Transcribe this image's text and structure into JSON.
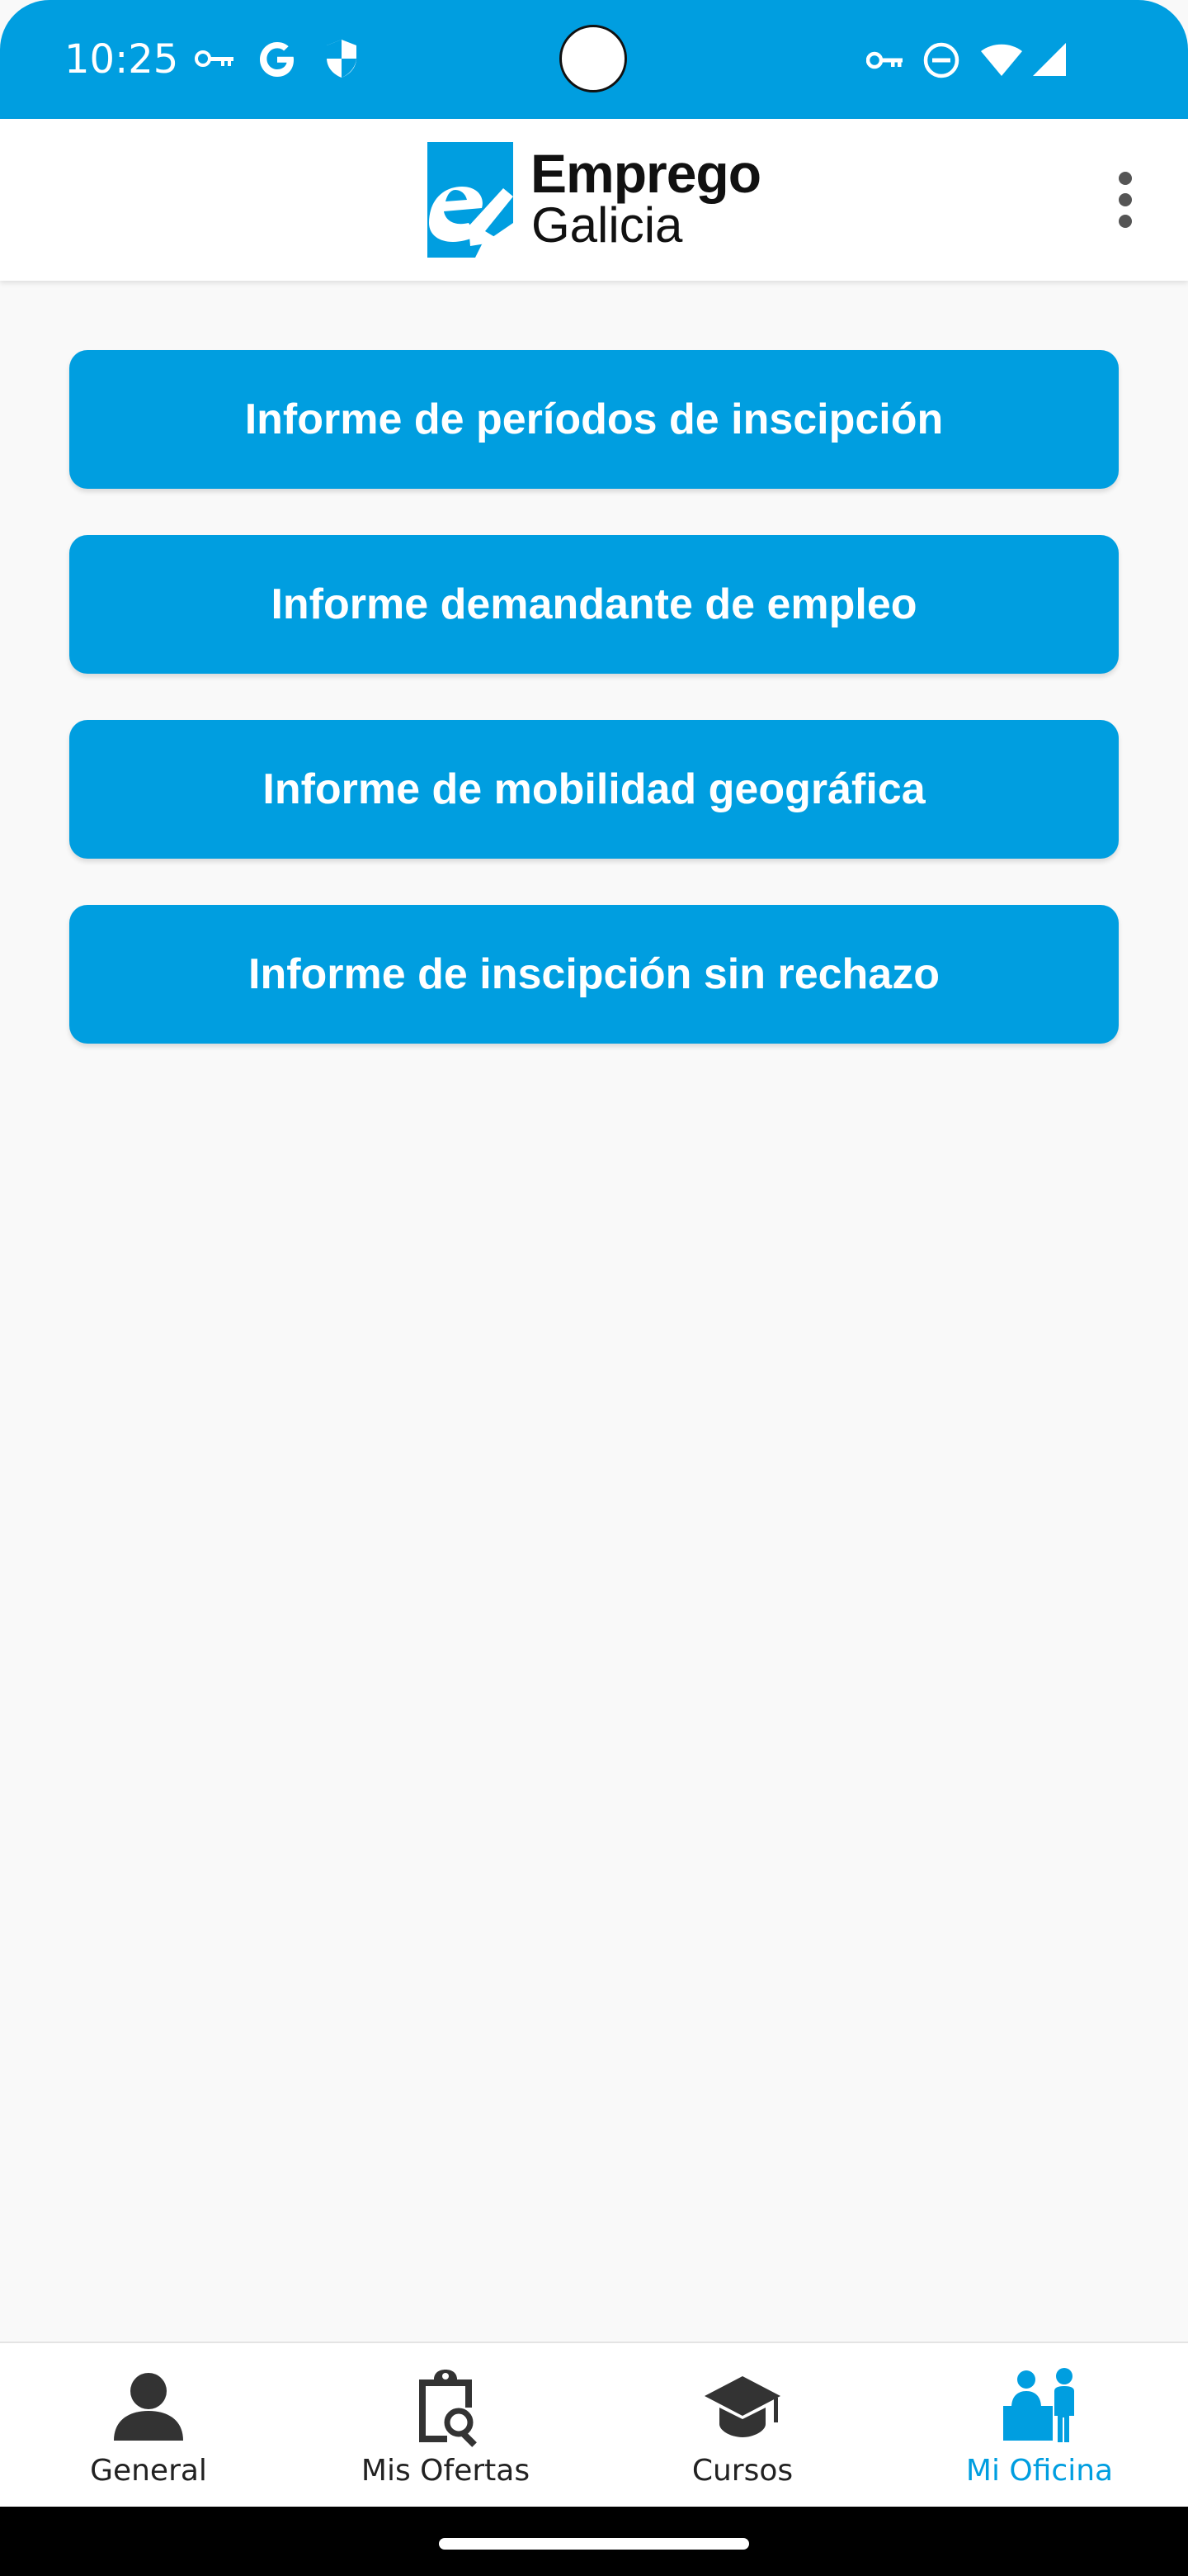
{
  "status_bar": {
    "time": "10:25",
    "background": "#009ee0",
    "icons_left": [
      "vpn-key-icon",
      "google-icon",
      "shield-icon"
    ],
    "icons_right": [
      "vpn-key-icon",
      "do-not-disturb-icon",
      "wifi-icon",
      "cellular-signal-icon"
    ]
  },
  "app_bar": {
    "logo_line1": "Emprego",
    "logo_line2": "Galicia",
    "menu_icon": "more-vert-icon"
  },
  "reports": [
    {
      "label": "Informe de períodos de inscipción"
    },
    {
      "label": "Informe demandante de empleo"
    },
    {
      "label": "Informe de mobilidad geográfica"
    },
    {
      "label": "Informe de inscipción sin rechazo"
    }
  ],
  "bottom_nav": {
    "items": [
      {
        "label": "General",
        "icon": "person-icon",
        "active": false
      },
      {
        "label": "Mis Ofertas",
        "icon": "clipboard-search-icon",
        "active": false
      },
      {
        "label": "Cursos",
        "icon": "graduation-cap-icon",
        "active": false
      },
      {
        "label": "Mi Oficina",
        "icon": "office-desk-icon",
        "active": true
      }
    ]
  },
  "colors": {
    "brand": "#009ee0",
    "background": "#f9f9f9",
    "text_dark": "#222222",
    "active": "#009ee0"
  }
}
